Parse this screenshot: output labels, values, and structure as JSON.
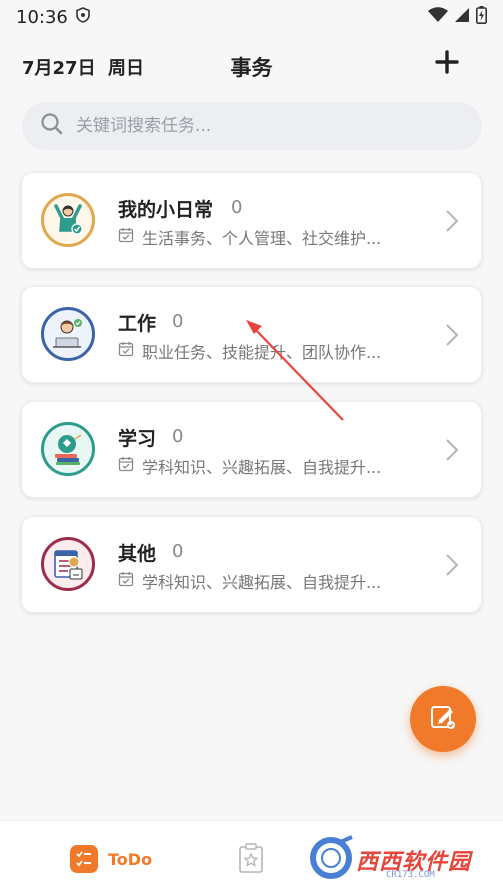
{
  "status_bar": {
    "time": "10:36"
  },
  "header": {
    "date": "7月27日",
    "weekday": "周日",
    "title": "事务"
  },
  "search": {
    "placeholder": "关键词搜索任务..."
  },
  "categories": [
    {
      "name": "我的小日常",
      "count": "0",
      "desc": "生活事务、个人管理、社交维护...",
      "color": "#e0a84e",
      "bg": "#fff7ea",
      "icon": "daily-person-icon"
    },
    {
      "name": "工作",
      "count": "0",
      "desc": "职业任务、技能提升、团队协作...",
      "color": "#3b63a8",
      "bg": "#eef3fb",
      "icon": "work-laptop-icon"
    },
    {
      "name": "学习",
      "count": "0",
      "desc": "学科知识、兴趣拓展、自我提升...",
      "color": "#2e9c8c",
      "bg": "#e9f7f4",
      "icon": "study-books-icon"
    },
    {
      "name": "其他",
      "count": "0",
      "desc": "学科知识、兴趣拓展、自我提升...",
      "color": "#9b2d4b",
      "bg": "#fbecef",
      "icon": "calendar-list-icon"
    }
  ],
  "bottom_nav": {
    "todo_label": "ToDo"
  },
  "watermark": {
    "text": "西西软件园",
    "sub": "CR173.COM"
  },
  "colors": {
    "accent": "#f07a2a",
    "annotation_arrow": "#e8463c"
  }
}
